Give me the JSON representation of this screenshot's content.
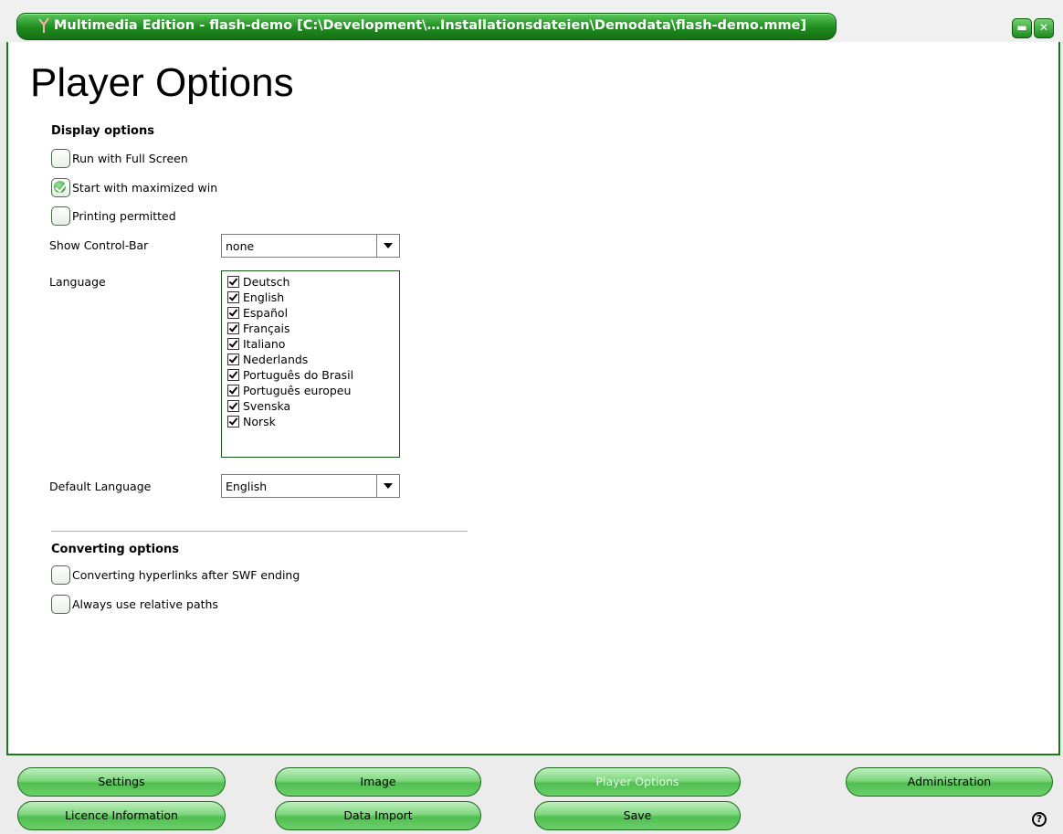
{
  "window": {
    "title": "Multimedia Edition - flash-demo [C:\\Development\\…Installationsdateien\\Demodata\\flash-demo.mme]",
    "minimize_icon": "minimize-icon",
    "close_icon": "close-icon"
  },
  "page": {
    "title": "Player Options"
  },
  "display_options": {
    "heading": "Display options",
    "full_screen": {
      "label": "Run with Full Screen",
      "checked": false
    },
    "maximized": {
      "label": "Start with maximized win",
      "checked": true
    },
    "printing": {
      "label": "Printing permitted",
      "checked": false
    },
    "control_bar_label": "Show Control-Bar",
    "control_bar_value": "none",
    "language_label": "Language",
    "languages": [
      "Deutsch",
      "English",
      "Español",
      "Français",
      "Italiano",
      "Nederlands",
      "Português do Brasil",
      "Português europeu",
      "Svenska",
      "Norsk"
    ],
    "default_language_label": "Default Language",
    "default_language_value": "English"
  },
  "converting_options": {
    "heading": "Converting options",
    "hyperlinks": {
      "label": "Converting hyperlinks after SWF ending",
      "checked": false
    },
    "relative_paths": {
      "label": "Always use relative paths",
      "checked": false
    }
  },
  "nav": {
    "settings": "Settings",
    "image": "Image",
    "player_options": "Player Options",
    "administration": "Administration",
    "licence": "Licence Information",
    "data_import": "Data Import",
    "save": "Save",
    "help": "?"
  },
  "colors": {
    "accent": "#1f8a1f",
    "button_light": "#bff0bf"
  }
}
